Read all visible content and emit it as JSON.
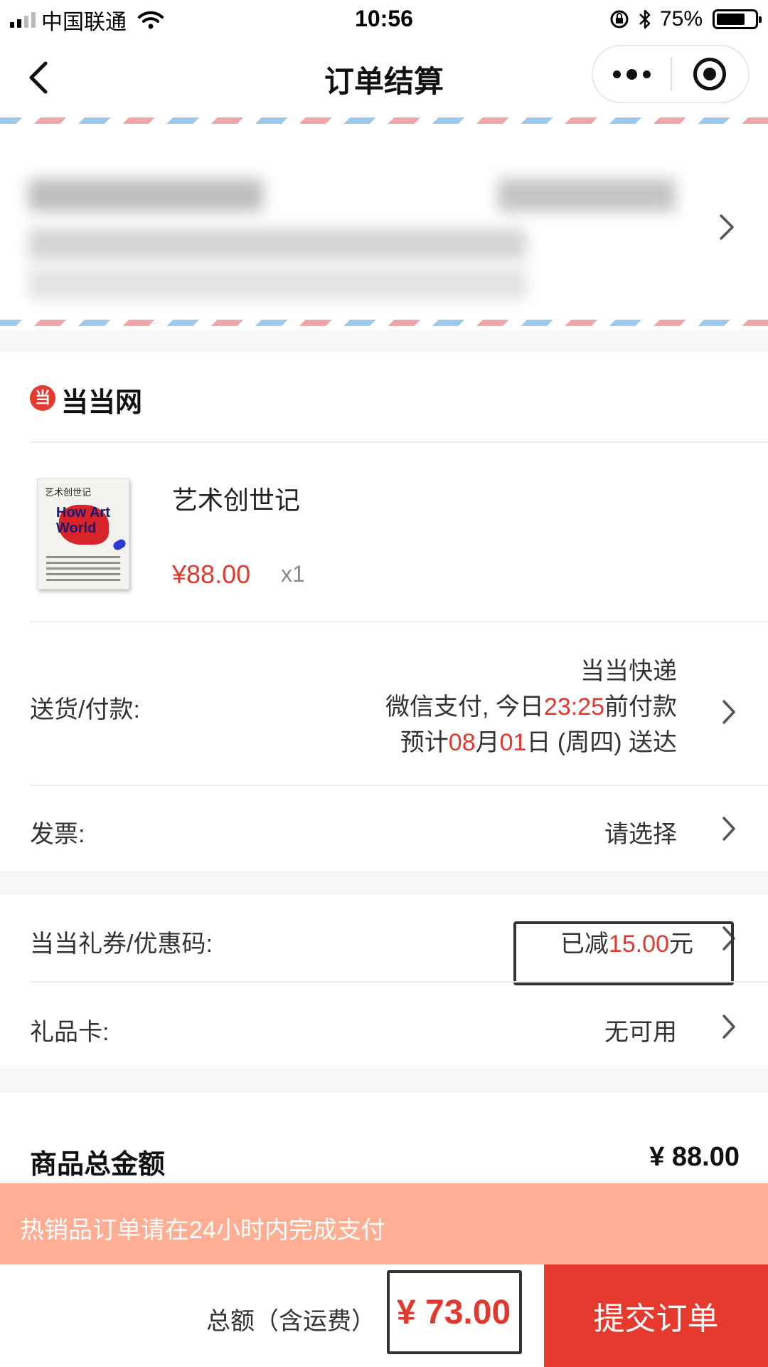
{
  "status_bar": {
    "carrier": "中国联通",
    "time": "10:56",
    "battery": "75%",
    "battery_level": 0.75
  },
  "nav": {
    "title": "订单结算"
  },
  "shop": {
    "logo_char": "当",
    "name": "当当网"
  },
  "product": {
    "cover_title": "艺术创世记",
    "cover_english": "How Art World",
    "name": "艺术创世记",
    "price": "¥88.00",
    "quantity": "x1"
  },
  "delivery": {
    "label": "送货/付款:",
    "line1": "当当快递",
    "line2_prefix": "微信支付, 今日",
    "line2_time": "23:25",
    "line2_suffix": "前付款",
    "line3_prefix": "预计",
    "line3_month": "08",
    "line3_mid": "月",
    "line3_day": "01",
    "line3_suffix": "日 (周四) 送达"
  },
  "invoice": {
    "label": "发票:",
    "value": "请选择"
  },
  "coupon": {
    "label": "当当礼券/优惠码:",
    "value_prefix": "已减",
    "value_amount": "15.00",
    "value_suffix": "元"
  },
  "gift_card": {
    "label": "礼品卡:",
    "value": "无可用"
  },
  "summary": {
    "label": "商品总金额",
    "value": "¥ 88.00"
  },
  "notice": "热销品订单请在24小时内完成支付",
  "footer": {
    "total_label": "总额（含运费）",
    "total_amount": "¥ 73.00",
    "submit_label": "提交订单"
  },
  "colors": {
    "accent_red": "#e63a2e",
    "notice_bg": "#ffad93"
  }
}
